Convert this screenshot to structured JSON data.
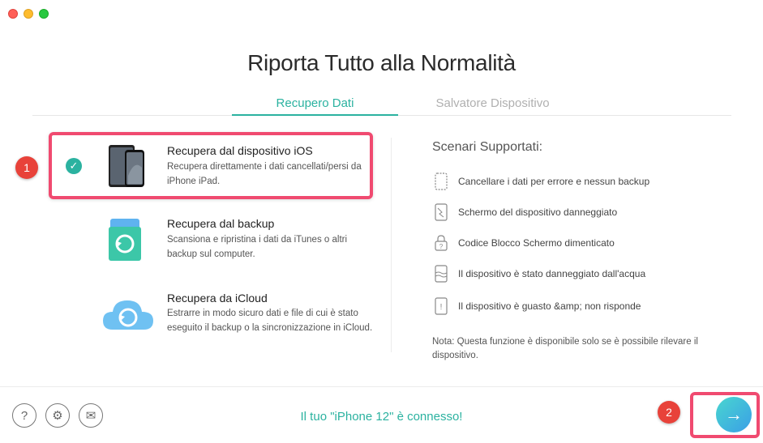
{
  "window": {
    "title": "Riporta Tutto alla Normalità"
  },
  "tabs": [
    {
      "label": "Recupero Dati",
      "active": true
    },
    {
      "label": "Salvatore Dispositivo",
      "active": false
    }
  ],
  "options": [
    {
      "title": "Recupera dal dispositivo iOS",
      "desc": "Recupera direttamente i dati cancellati/persi da iPhone iPad.",
      "icon": "iphone-ipad-icon",
      "selected": true
    },
    {
      "title": "Recupera dal backup",
      "desc": "Scansiona e ripristina i dati da iTunes o altri backup sul computer.",
      "icon": "backup-file-icon",
      "selected": false
    },
    {
      "title": "Recupera da iCloud",
      "desc": "Estrarre in modo sicuro dati e file di cui è stato eseguito il backup o la sincronizzazione in iCloud.",
      "icon": "icloud-icon",
      "selected": false
    }
  ],
  "scenarios": {
    "title": "Scenari Supportati:",
    "items": [
      {
        "label": "Cancellare i dati per errore e nessun backup",
        "icon": "deleted-phone-icon"
      },
      {
        "label": "Schermo del dispositivo danneggiato",
        "icon": "broken-screen-icon"
      },
      {
        "label": "Codice Blocco Schermo dimenticato",
        "icon": "lock-question-icon"
      },
      {
        "label": "Il dispositivo è stato danneggiato dall'acqua",
        "icon": "water-damage-icon"
      },
      {
        "label": "Il dispositivo è guasto &amp; non risponde",
        "icon": "warning-phone-icon"
      }
    ],
    "note": "Nota: Questa funzione è disponibile solo se è possibile rilevare il dispositivo."
  },
  "annotations": {
    "badge1": "1",
    "badge2": "2"
  },
  "footer": {
    "status": "Il tuo \"iPhone 12\" è connesso!",
    "help_icon": "?",
    "settings_icon": "⚙",
    "mail_icon": "✉",
    "next_icon": "→"
  },
  "colors": {
    "accent": "#2bb2a0",
    "highlight": "#f04a70",
    "badge": "#e8423a"
  }
}
